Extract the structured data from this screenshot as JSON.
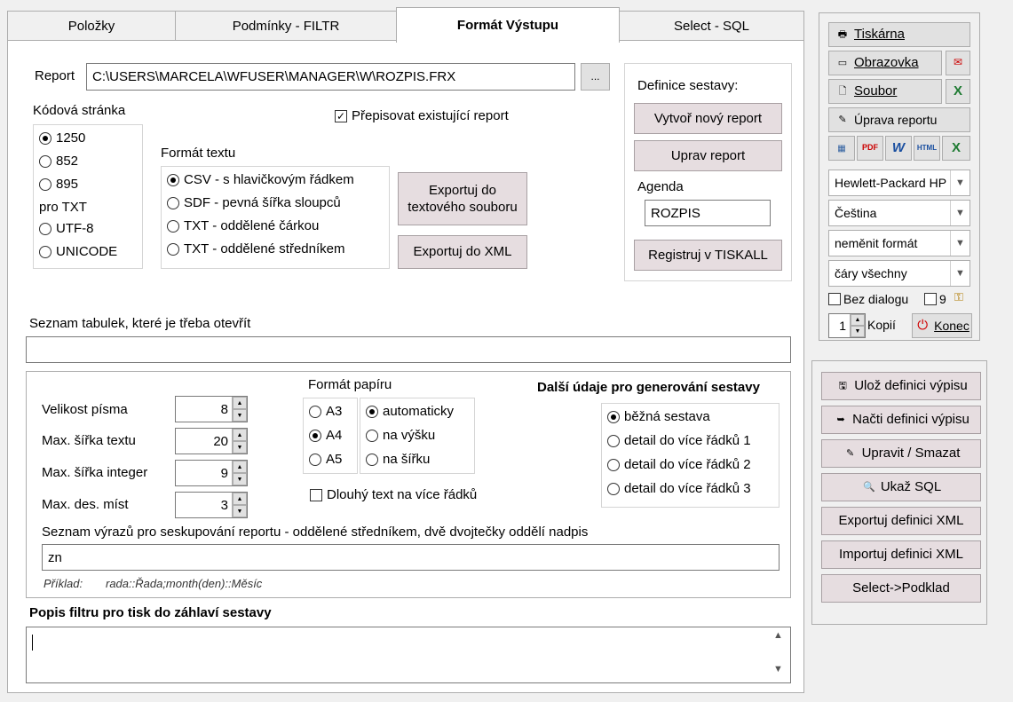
{
  "tabs": [
    {
      "label": "Položky"
    },
    {
      "label": "Podmínky - FILTR"
    },
    {
      "label": "Formát Výstupu"
    },
    {
      "label": "Select - SQL"
    }
  ],
  "report": {
    "label": "Report",
    "value": "C:\\USERS\\MARCELA\\WFUSER\\MANAGER\\W\\ROZPIS.FRX",
    "browse": "..."
  },
  "codepage": {
    "label": "Kódová stránka",
    "options": [
      "1250",
      "852",
      "895",
      "UTF-8",
      "UNICODE"
    ],
    "note": "pro TXT",
    "selected": "1250"
  },
  "overwrite": {
    "label": "Přepisovat existující report",
    "checked": true
  },
  "text_format": {
    "label": "Formát textu",
    "options": [
      "CSV - s hlavičkovým řádkem",
      "SDF - pevná šířka sloupců",
      "TXT - oddělené čárkou",
      "TXT - oddělené středníkem"
    ],
    "selected": "CSV - s hlavičkovým řádkem"
  },
  "export": {
    "text": "Exportuj do textového souboru",
    "xml": "Exportuj do XML"
  },
  "definition": {
    "label": "Definice sestavy:",
    "new": "Vytvoř nový report",
    "edit": "Uprav report",
    "agenda_label": "Agenda",
    "agenda_value": "ROZPIS",
    "register": "Registruj v TISKALL"
  },
  "tables": {
    "label": "Seznam tabulek, které je třeba otevřít",
    "value": ""
  },
  "font": {
    "size_label": "Velikost písma",
    "size": "8",
    "width_label": "Max. šířka textu",
    "width": "20",
    "int_label": "Max. šířka integer",
    "int": "9",
    "dec_label": "Max. des. míst",
    "dec": "3"
  },
  "paper": {
    "label": "Formát papíru",
    "sizes": [
      "A3",
      "A4",
      "A5"
    ],
    "size_selected": "A4",
    "orient": [
      "automaticky",
      "na výšku",
      "na šířku"
    ],
    "orient_selected": "automaticky"
  },
  "longtext": {
    "label": "Dlouhý text na více řádků",
    "checked": false
  },
  "more": {
    "label": "Další údaje pro generování sestavy",
    "options": [
      "běžná sestava",
      "detail do více řádků 1",
      "detail do více řádků 2",
      "detail do více řádků 3"
    ],
    "selected": "běžná sestava"
  },
  "grouping": {
    "label": "Seznam výrazů pro seskupování reportu - oddělené středníkem, dvě dvojtečky oddělí nadpis",
    "value": "zn",
    "example_label": "Příklad:",
    "example": "rada::Řada;month(den)::Měsíc"
  },
  "filter": {
    "label": "Popis filtru pro tisk do záhlaví sestavy",
    "value": ""
  },
  "output": {
    "printer": "Tiskárna",
    "screen": "Obrazovka",
    "file": "Soubor",
    "edit": "Úprava reportu"
  },
  "formats": [
    "XLS",
    "PDF",
    "W",
    "HTML",
    "XLSX"
  ],
  "combos": {
    "printer": "Hewlett-Packard HP",
    "language": "Čeština",
    "format": "neměnit formát",
    "lines": "čáry všechny"
  },
  "nodialog": {
    "label": "Bez dialogu",
    "checked": false,
    "nine": "9"
  },
  "copies": {
    "value": "1",
    "label": "Kopií",
    "end": "Konec"
  },
  "actions": {
    "save": "Ulož definici výpisu",
    "load": "Načti definici výpisu",
    "edit": "Upravit / Smazat",
    "sql": "Ukaž SQL",
    "export_xml": "Exportuj definici XML",
    "import_xml": "Importuj definici XML",
    "select": "Select->Podklad"
  },
  "colors": {
    "accent": "#e6dde0",
    "power": "#d00000"
  }
}
